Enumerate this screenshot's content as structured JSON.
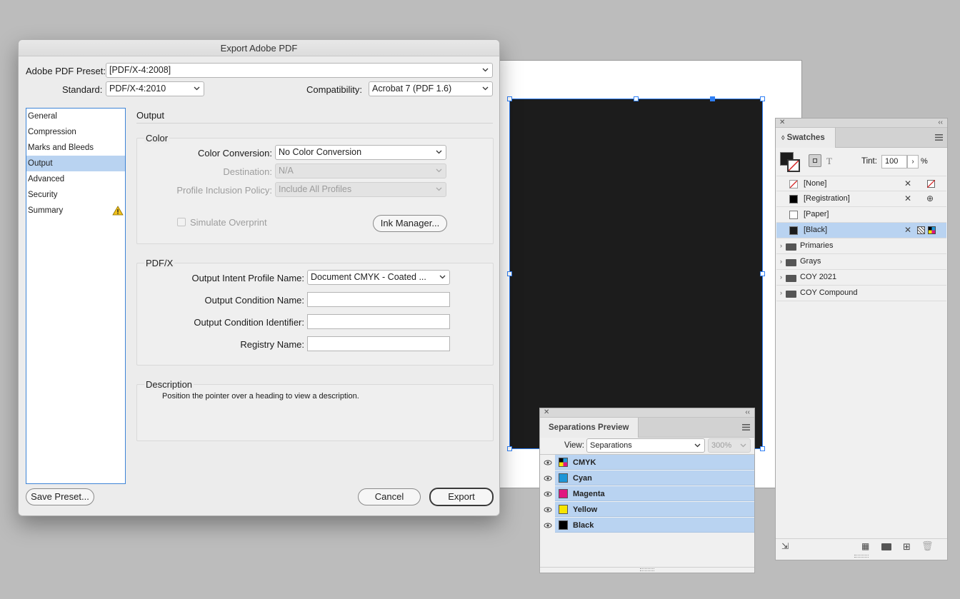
{
  "dialog": {
    "title": "Export Adobe PDF",
    "preset_label": "Adobe PDF Preset:",
    "preset_value": "[PDF/X-4:2008]",
    "standard_label": "Standard:",
    "standard_value": "PDF/X-4:2010",
    "compatibility_label": "Compatibility:",
    "compatibility_value": "Acrobat 7 (PDF 1.6)",
    "nav": [
      {
        "label": "General"
      },
      {
        "label": "Compression"
      },
      {
        "label": "Marks and Bleeds"
      },
      {
        "label": "Output",
        "active": true
      },
      {
        "label": "Advanced"
      },
      {
        "label": "Security"
      },
      {
        "label": "Summary",
        "warning": true
      }
    ],
    "section_title": "Output",
    "color": {
      "group_title": "Color",
      "conversion_label": "Color Conversion:",
      "conversion_value": "No Color Conversion",
      "destination_label": "Destination:",
      "destination_value": "N/A",
      "inclusion_label": "Profile Inclusion Policy:",
      "inclusion_value": "Include All Profiles",
      "simulate_label": "Simulate Overprint",
      "ink_manager_label": "Ink Manager..."
    },
    "pdfx": {
      "group_title": "PDF/X",
      "intent_label": "Output Intent Profile Name:",
      "intent_value": "Document CMYK - Coated ...",
      "condition_name_label": "Output Condition Name:",
      "condition_name_value": "",
      "condition_id_label": "Output Condition Identifier:",
      "condition_id_value": "",
      "registry_label": "Registry Name:",
      "registry_value": ""
    },
    "description": {
      "group_title": "Description",
      "text": "Position the pointer over a heading to view a description."
    },
    "buttons": {
      "save_preset": "Save Preset...",
      "cancel": "Cancel",
      "export": "Export"
    }
  },
  "swatches": {
    "tab": "Swatches",
    "tint_label": "Tint:",
    "tint_value": "100",
    "tint_unit": "%",
    "items": [
      {
        "label": "[None]"
      },
      {
        "label": "[Registration]"
      },
      {
        "label": "[Paper]"
      },
      {
        "label": "[Black]",
        "selected": true
      }
    ],
    "groups": [
      {
        "label": "Primaries"
      },
      {
        "label": "Grays"
      },
      {
        "label": "COY 2021"
      },
      {
        "label": "COY Compound"
      }
    ]
  },
  "separations": {
    "tab": "Separations Preview",
    "view_label": "View:",
    "view_value": "Separations",
    "zoom_value": "300%",
    "inks": [
      {
        "name": "CMYK",
        "color": "#ffffff"
      },
      {
        "name": "Cyan",
        "color": "#1e96d8"
      },
      {
        "name": "Magenta",
        "color": "#e0177f"
      },
      {
        "name": "Yellow",
        "color": "#f7e500"
      },
      {
        "name": "Black",
        "color": "#000000"
      }
    ]
  }
}
